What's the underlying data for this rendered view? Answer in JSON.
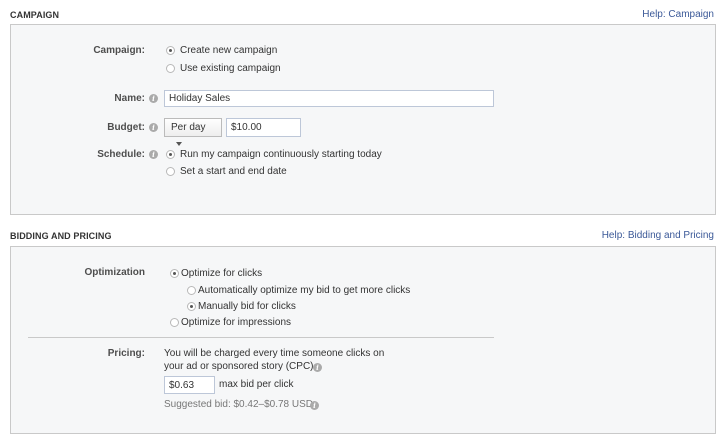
{
  "campaign_section": {
    "title": "CAMPAIGN",
    "help": "Help: Campaign",
    "campaign_label": "Campaign:",
    "campaign_options": [
      "Create new campaign",
      "Use existing campaign"
    ],
    "campaign_selected": 0,
    "name_label": "Name:",
    "name_value": "Holiday Sales",
    "budget_label": "Budget:",
    "budget_period": "Per day",
    "budget_value": "$10.00",
    "schedule_label": "Schedule:",
    "schedule_options": [
      "Run my campaign continuously starting today",
      "Set a start and end date"
    ],
    "schedule_selected": 0
  },
  "bidding_section": {
    "title": "BIDDING AND PRICING",
    "help": "Help: Bidding and Pricing",
    "optimization_label": "Optimization",
    "opt_clicks": "Optimize for clicks",
    "opt_auto": "Automatically optimize my bid to get more clicks",
    "opt_manual": "Manually bid for clicks",
    "opt_impressions": "Optimize for impressions",
    "pricing_label": "Pricing:",
    "pricing_text_1": "You will be charged every time someone clicks on",
    "pricing_text_2": "your ad or sponsored story (CPC).",
    "bid_value": "$0.63",
    "bid_suffix": "max bid per click",
    "suggested": "Suggested bid: $0.42–$0.78 USD"
  },
  "icons": {
    "info": "info-icon",
    "dropdown": "chevron-down-icon"
  }
}
